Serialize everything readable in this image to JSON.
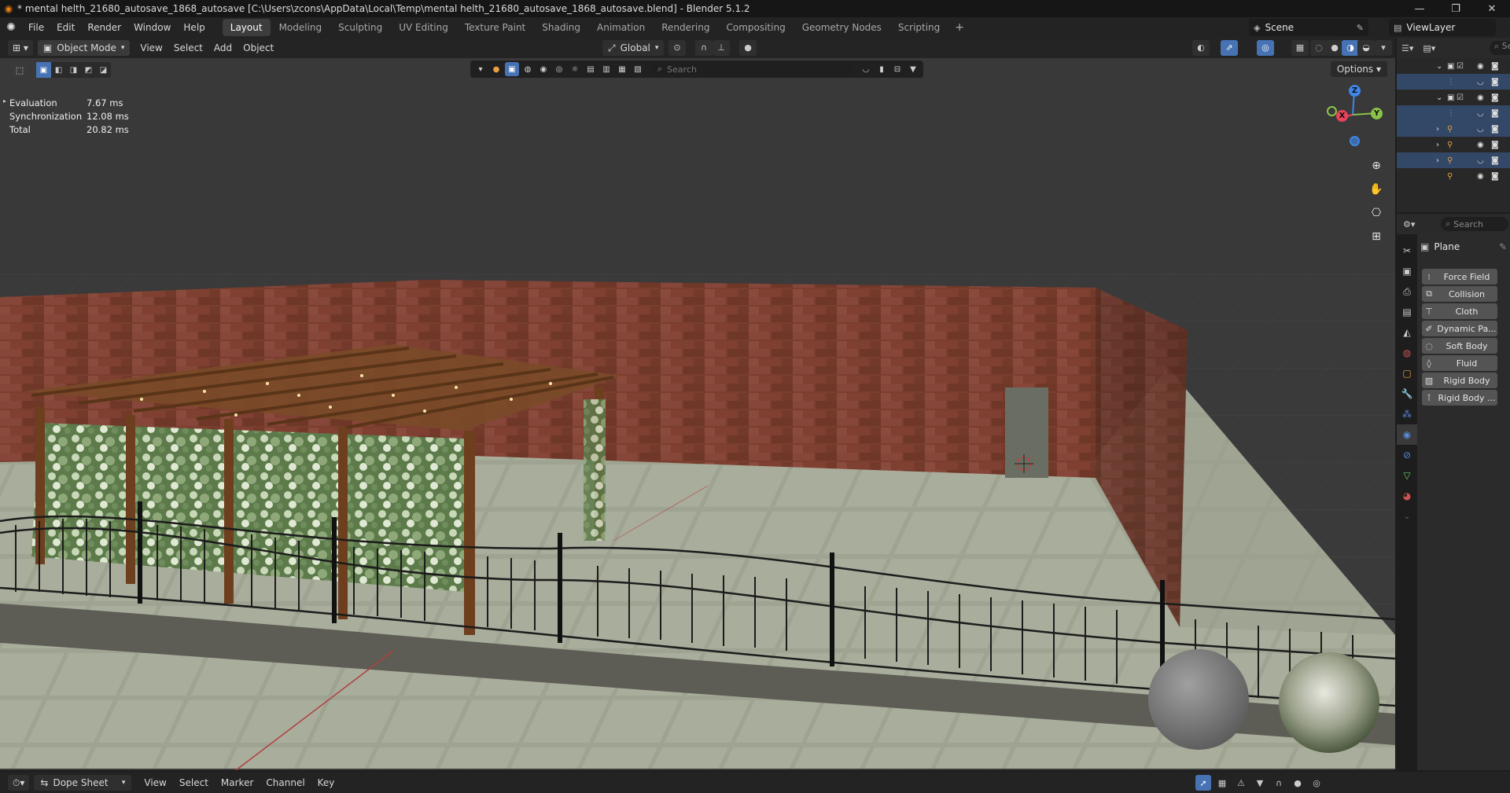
{
  "window": {
    "title": "* mental helth_21680_autosave_1868_autosave [C:\\Users\\zcons\\AppData\\Local\\Temp\\mental helth_21680_autosave_1868_autosave.blend] - Blender 5.1.2",
    "minimize": "—",
    "maximize": "❐",
    "close": "✕"
  },
  "menus": [
    "File",
    "Edit",
    "Render",
    "Window",
    "Help"
  ],
  "workspaces": [
    "Layout",
    "Modeling",
    "Sculpting",
    "UV Editing",
    "Texture Paint",
    "Shading",
    "Animation",
    "Rendering",
    "Compositing",
    "Geometry Nodes",
    "Scripting"
  ],
  "active_workspace": "Layout",
  "scene": {
    "name": "Scene"
  },
  "view_layer": {
    "name": "ViewLayer"
  },
  "viewport_header": {
    "mode": "Object Mode",
    "menus": [
      "View",
      "Select",
      "Add",
      "Object"
    ],
    "transform_orientation": "Global",
    "options_label": "Options"
  },
  "visibility_toolbar": {
    "search_placeholder": "Search"
  },
  "stats": [
    {
      "label": "Evaluation",
      "value": "7.67 ms"
    },
    {
      "label": "Synchronization",
      "value": "12.08 ms"
    },
    {
      "label": "Total",
      "value": "20.82 ms"
    }
  ],
  "gizmo": {
    "x": "X",
    "y": "Y",
    "z": "Z"
  },
  "outliner": {
    "search_placeholder": "Sea"
  },
  "properties": {
    "search_placeholder": "Search",
    "object_name": "Plane",
    "physics_buttons": [
      "Force Field",
      "Collision",
      "Cloth",
      "Dynamic Pa...",
      "Soft Body",
      "Fluid",
      "Rigid Body",
      "Rigid Body ..."
    ]
  },
  "bottom_bar": {
    "editor": "Dope Sheet",
    "menus": [
      "View",
      "Select",
      "Marker",
      "Channel",
      "Key"
    ]
  },
  "colors": {
    "accent": "#4772b3",
    "axis_x": "#e8445a",
    "axis_y": "#8bc34a",
    "axis_z": "#3f86e8",
    "brick": "#7a3e2e",
    "floor": "#9a9e8e"
  }
}
